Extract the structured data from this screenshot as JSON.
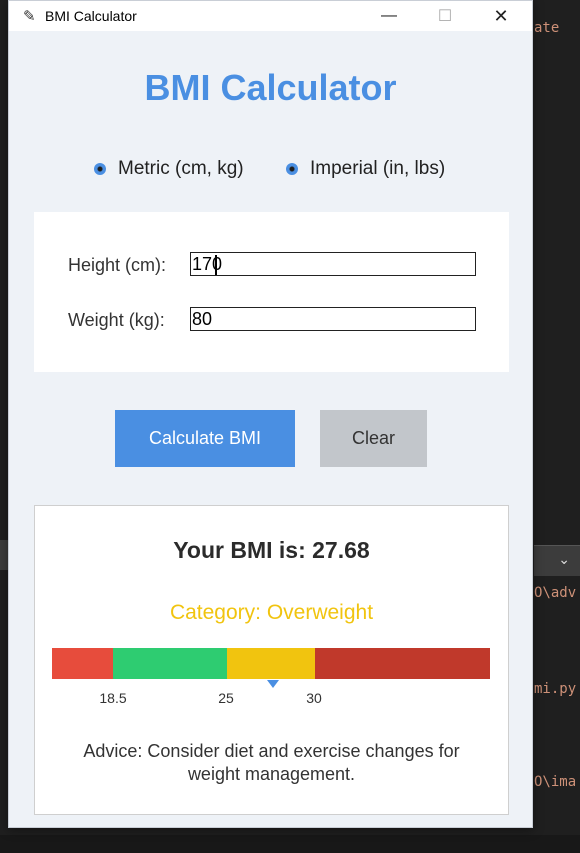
{
  "background": {
    "right_fragments": [
      "ate",
      "O\\adv",
      "mi.py",
      "O\\ima"
    ],
    "dropdown_icon": "chevron-down-icon"
  },
  "window": {
    "title": "BMI Calculator",
    "controls": {
      "minimize": "—",
      "maximize": "☐",
      "close": "✕"
    }
  },
  "app": {
    "title": "BMI Calculator",
    "units": {
      "metric_label": "Metric (cm, kg)",
      "imperial_label": "Imperial (in, lbs)",
      "selected": "metric"
    },
    "height": {
      "label": "Height (cm):",
      "value": "170"
    },
    "weight": {
      "label": "Weight (kg):",
      "value": "80"
    },
    "buttons": {
      "calculate": "Calculate BMI",
      "clear": "Clear"
    },
    "result": {
      "bmi_text": "Your BMI is: 27.68",
      "bmi_value": 27.68,
      "category_text": "Category: Overweight",
      "category_color": "#f1c40f",
      "scale": {
        "ticks": [
          "18.5",
          "25",
          "30"
        ],
        "colors": {
          "under": "#e74c3c",
          "normal": "#2ecc71",
          "over": "#f1c40f",
          "obese": "#c0392b"
        }
      },
      "advice": "Advice: Consider diet and exercise changes for weight management."
    }
  },
  "accent_color": "#4a8fe2"
}
